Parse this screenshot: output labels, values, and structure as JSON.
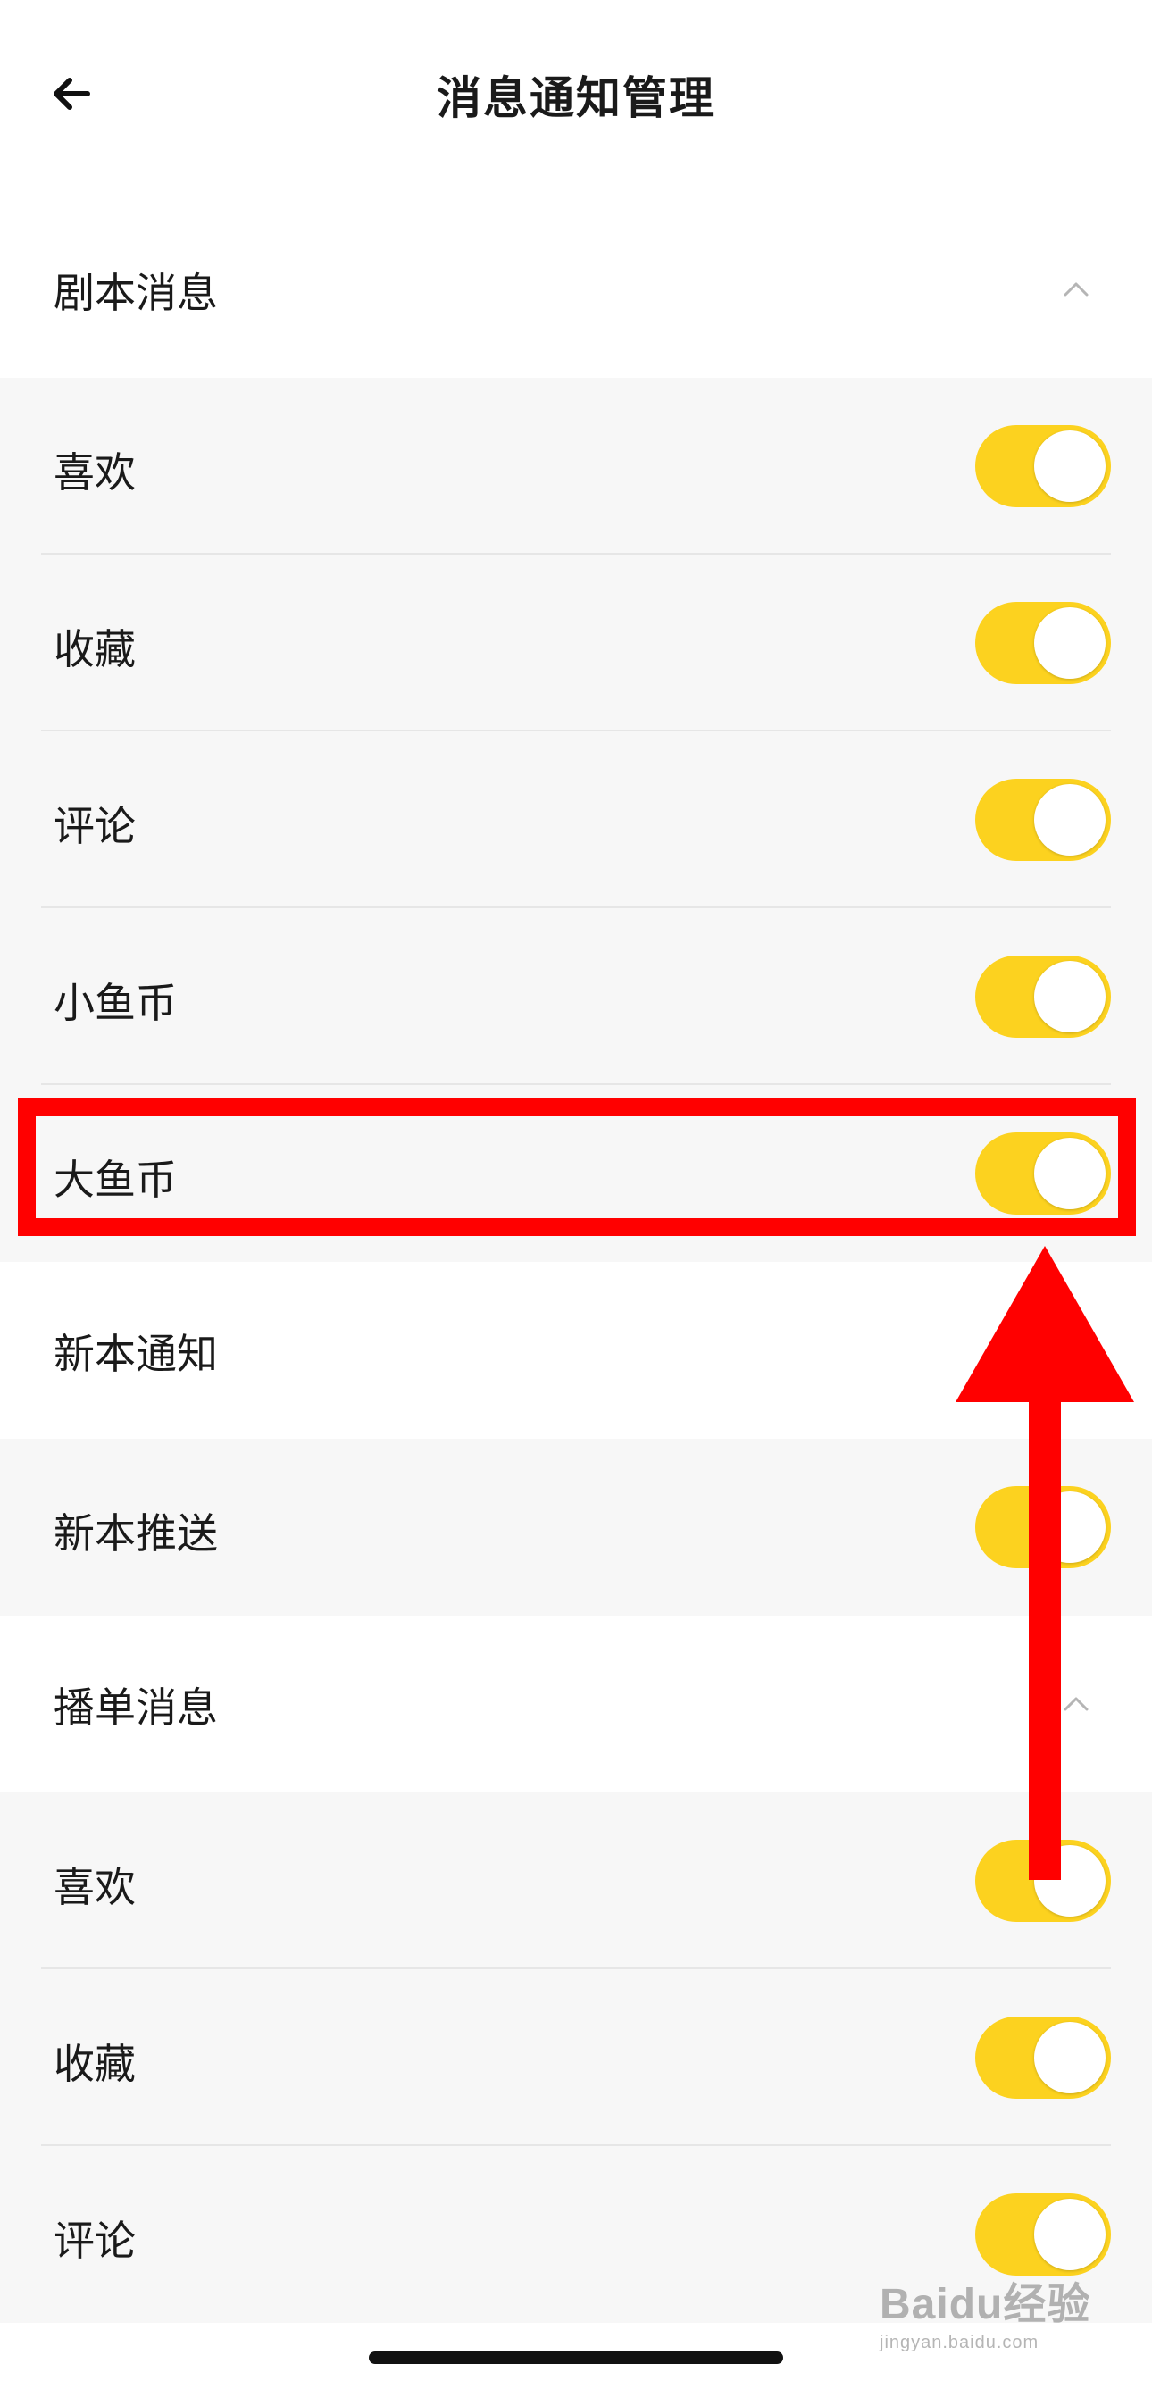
{
  "header": {
    "title": "消息通知管理",
    "back_icon": "arrow-left-icon"
  },
  "sections": [
    {
      "title": "剧本消息",
      "expanded": true,
      "items": [
        {
          "label": "喜欢",
          "enabled": true
        },
        {
          "label": "收藏",
          "enabled": true
        },
        {
          "label": "评论",
          "enabled": true
        },
        {
          "label": "小鱼币",
          "enabled": true
        },
        {
          "label": "大鱼币",
          "enabled": true
        }
      ]
    },
    {
      "title": "新本通知",
      "items": [
        {
          "label": "新本推送",
          "enabled": true
        }
      ]
    },
    {
      "title": "播单消息",
      "expanded": true,
      "items": [
        {
          "label": "喜欢",
          "enabled": true
        },
        {
          "label": "收藏",
          "enabled": true
        },
        {
          "label": "评论",
          "enabled": true
        }
      ]
    }
  ],
  "watermark": {
    "logo": "Baidu经验",
    "sub": "jingyan.baidu.com"
  },
  "colors": {
    "toggle_on": "#fcd21f",
    "annotation": "#ff0000",
    "row_bg": "#f7f7f7"
  }
}
